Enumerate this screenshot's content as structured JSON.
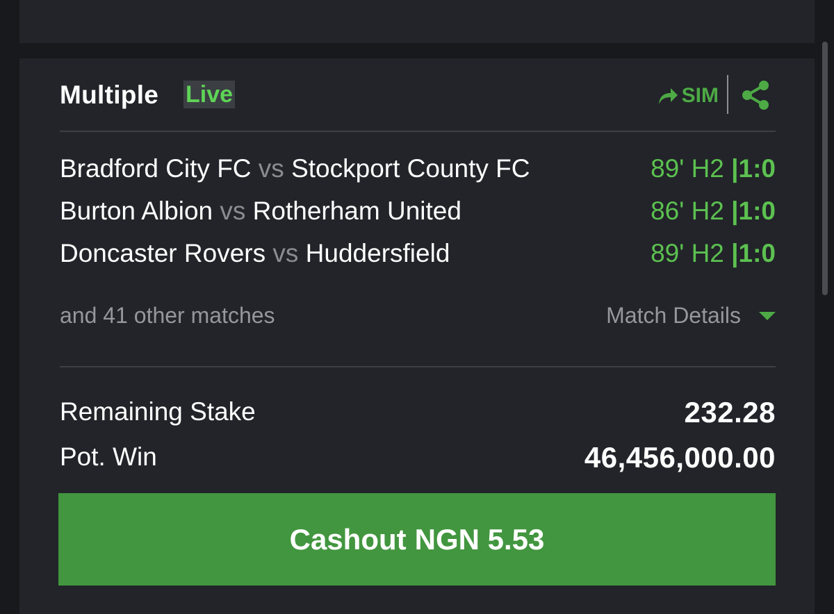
{
  "bet": {
    "title": "Multiple",
    "live_badge": "Live",
    "sim_label": "SIM",
    "matches": [
      {
        "home": "Bradford City FC",
        "vs": "vs",
        "away": "Stockport County FC",
        "time": "89' H2",
        "sep": "|",
        "score": "1:0"
      },
      {
        "home": "Burton Albion",
        "vs": "vs",
        "away": "Rotherham United",
        "time": "86' H2",
        "sep": "|",
        "score": "1:0"
      },
      {
        "home": "Doncaster Rovers",
        "vs": "vs",
        "away": "Huddersfield",
        "time": "89' H2",
        "sep": "|",
        "score": "1:0"
      }
    ],
    "other_matches": "and 41 other matches",
    "match_details_label": "Match Details",
    "remaining_stake_label": "Remaining Stake",
    "remaining_stake_value": "232.28",
    "pot_win_label": "Pot. Win",
    "pot_win_value": "46,456,000.00",
    "cashout_label": "Cashout",
    "cashout_amount": "NGN 5.53"
  },
  "icons": {
    "sim": "forward-arrow-icon",
    "share": "share-icon",
    "details": "caret-down-icon"
  },
  "colors": {
    "accent_green": "#42963f",
    "live_green": "#5fd357",
    "status_green": "#5cc150",
    "card_bg": "#222429",
    "page_bg": "#18191c"
  }
}
